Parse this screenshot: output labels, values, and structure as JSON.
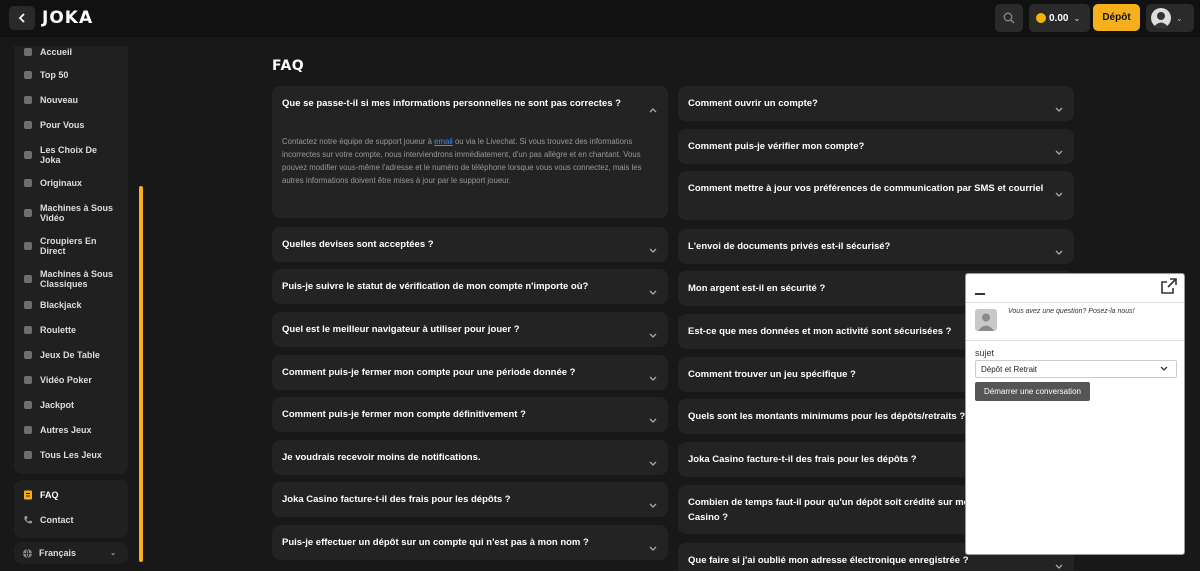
{
  "header": {
    "logo": "JOKA",
    "balance": "0.00",
    "depot_label": "Dépôt"
  },
  "sidebar": {
    "items": [
      {
        "label": "Accueil",
        "icon": "home-icon"
      },
      {
        "label": "Top 50",
        "icon": "rocket-icon"
      },
      {
        "label": "Nouveau",
        "icon": "star-icon"
      },
      {
        "label": "Pour Vous",
        "icon": "user-icon"
      },
      {
        "label": "Les Choix De Joka",
        "icon": "crown-icon"
      },
      {
        "label": "Originaux",
        "icon": "j-icon"
      },
      {
        "label": "Machines à Sous Vidéo",
        "icon": "slot-icon"
      },
      {
        "label": "Croupiers En Direct",
        "icon": "dealer-icon"
      },
      {
        "label": "Machines à Sous Classiques",
        "icon": "cherry-icon"
      },
      {
        "label": "Blackjack",
        "icon": "cards-icon"
      },
      {
        "label": "Roulette",
        "icon": "roulette-icon"
      },
      {
        "label": "Jeux De Table",
        "icon": "dice-icon"
      },
      {
        "label": "Vidéo Poker",
        "icon": "poker-chip-icon"
      },
      {
        "label": "Jackpot",
        "icon": "jackpot-icon"
      },
      {
        "label": "Autres Jeux",
        "icon": "gamepad-icon"
      },
      {
        "label": "Tous Les Jeux",
        "icon": "grid-icon"
      }
    ],
    "faq_label": "FAQ",
    "contact_label": "Contact",
    "language": "Français",
    "accent_color": "#f6b01c"
  },
  "faq": {
    "title": "FAQ",
    "left": [
      {
        "question": "Que se passe-t-il si mes informations personnelles ne sont pas correctes ?",
        "expanded": true,
        "answer_pre": "Contactez notre équipe de support joueur à ",
        "answer_link": "email",
        "answer_post": " ou via le Livechat. Si vous trouvez des informations incorrectes sur votre compte, nous interviendrons immédiatement, d'un pas allègre et en chantant. Vous pouvez modifier vous-même l'adresse et le numéro de téléphone lorsque vous vous connectez, mais les autres informations doivent être mises à jour par le support joueur."
      },
      {
        "question": "Quelles devises sont acceptées ?"
      },
      {
        "question": "Puis-je suivre le statut de vérification de mon compte n'importe où?"
      },
      {
        "question": "Quel est le meilleur navigateur à utiliser pour jouer ?"
      },
      {
        "question": "Comment puis-je fermer mon compte pour une période donnée ?"
      },
      {
        "question": "Comment puis-je fermer mon compte définitivement ?"
      },
      {
        "question": "Je voudrais recevoir moins de notifications."
      },
      {
        "question": "Joka Casino facture-t-il des frais pour les dépôts ?"
      },
      {
        "question": "Puis-je effectuer un dépôt sur un compte qui n'est pas à mon nom ?"
      }
    ],
    "right": [
      {
        "question": "Comment ouvrir un compte?"
      },
      {
        "question": "Comment puis-je vérifier mon compte?"
      },
      {
        "question": "Comment mettre à jour vos préférences de communication par SMS et courriel"
      },
      {
        "question": "L'envoi de documents privés est-il sécurisé?"
      },
      {
        "question": "Mon argent est-il en sécurité ?"
      },
      {
        "question": "Est-ce que mes données et mon activité sont sécurisées ?"
      },
      {
        "question": "Comment trouver un jeu spécifique ?"
      },
      {
        "question": "Quels sont les montants minimums pour les dépôts/retraits ?"
      },
      {
        "question": "Joka Casino facture-t-il des frais pour les dépôts ?"
      },
      {
        "question": "Combien de temps faut-il pour qu'un dépôt soit crédité sur mon compte Joka Casino ?"
      },
      {
        "question": "Que faire si j'ai oublié mon adresse électronique enregistrée ?"
      }
    ]
  },
  "chat": {
    "prompt": "Vous avez une question? Posez-la nous!",
    "subject_label": "sujet",
    "subject_value": "Dépôt et Retrait",
    "start_button": "Démarrer une conversation"
  }
}
